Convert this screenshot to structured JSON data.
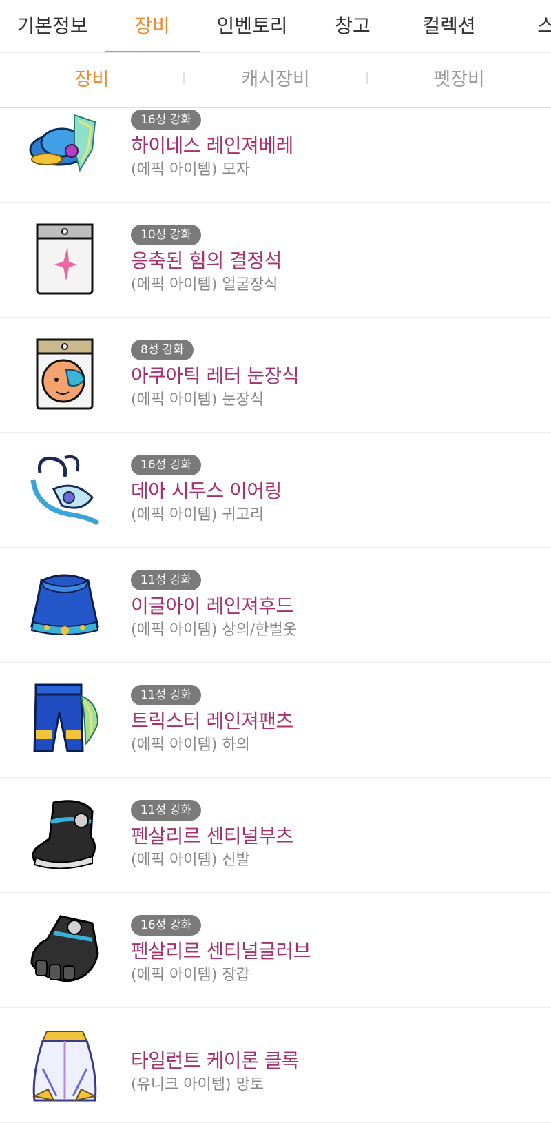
{
  "tabs": [
    {
      "label": "기본정보",
      "active": false
    },
    {
      "label": "장비",
      "active": true
    },
    {
      "label": "인벤토리",
      "active": false
    },
    {
      "label": "창고",
      "active": false
    },
    {
      "label": "컬렉션",
      "active": false
    },
    {
      "label": "스킬",
      "active": false
    }
  ],
  "subtabs": [
    {
      "label": "장비",
      "active": true
    },
    {
      "label": "캐시장비",
      "active": false
    },
    {
      "label": "펫장비",
      "active": false
    }
  ],
  "items": [
    {
      "badge": "16성 강화",
      "name": "하이네스 레인져베레",
      "type": "(에픽 아이템) 모자",
      "icon": "hat-icon"
    },
    {
      "badge": "10성 강화",
      "name": "응축된 힘의 결정석",
      "type": "(에픽 아이템) 얼굴장식",
      "icon": "face-accessory-icon"
    },
    {
      "badge": "8성 강화",
      "name": "아쿠아틱 레터 눈장식",
      "type": "(에픽 아이템) 눈장식",
      "icon": "eye-accessory-icon"
    },
    {
      "badge": "16성 강화",
      "name": "데아 시두스 이어링",
      "type": "(에픽 아이템) 귀고리",
      "icon": "earring-icon"
    },
    {
      "badge": "11성 강화",
      "name": "이글아이 레인져후드",
      "type": "(에픽 아이템) 상의/한벌옷",
      "icon": "top-icon"
    },
    {
      "badge": "11성 강화",
      "name": "트릭스터 레인져팬츠",
      "type": "(에픽 아이템) 하의",
      "icon": "pants-icon"
    },
    {
      "badge": "11성 강화",
      "name": "펜살리르 센티널부츠",
      "type": "(에픽 아이템) 신발",
      "icon": "boots-icon"
    },
    {
      "badge": "16성 강화",
      "name": "펜살리르 센티널글러브",
      "type": "(에픽 아이템) 장갑",
      "icon": "gloves-icon"
    },
    {
      "badge": "",
      "name": "타일런트 케이론 클록",
      "type": "(유니크 아이템) 망토",
      "icon": "cape-icon"
    }
  ],
  "colors": {
    "accent": "#ef8a2d",
    "item_name": "#a8306f",
    "badge_bg": "#7a7a7a"
  }
}
